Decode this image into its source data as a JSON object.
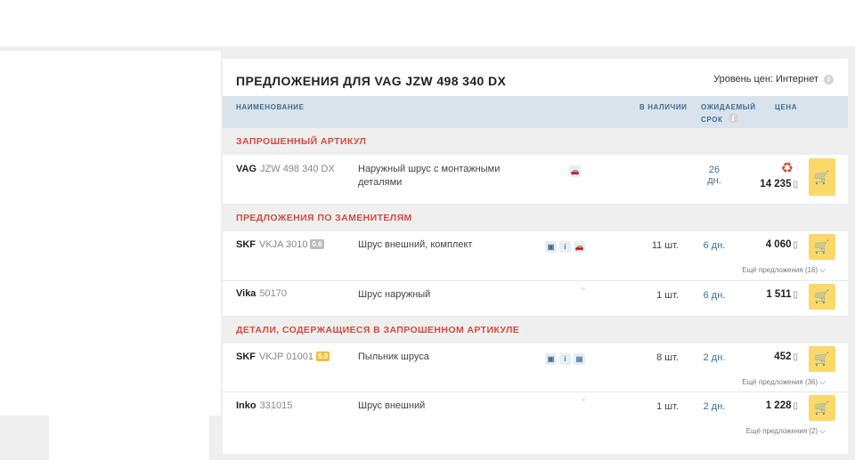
{
  "title": "ПРЕДЛОЖЕНИЯ ДЛЯ VAG JZW 498 340 DX",
  "price_level": "Уровень цен: Интернет",
  "columns": {
    "name": "НАИМЕНОВАНИЕ",
    "in_stock": "В НАЛИЧИИ",
    "expected_1": "ОЖИДАЕМЫЙ",
    "expected_2": "СРОК",
    "price": "ЦЕНА"
  },
  "sections": {
    "requested": "ЗАПРОШЕННЫЙ АРТИКУЛ",
    "replacements": "ПРЕДЛОЖЕНИЯ ПО ЗАМЕНИТЕЛЯМ",
    "contained": "ДЕТАЛИ, СОДЕРЖАЩИЕСЯ В ЗАПРОШЕННОМ АРТИКУЛЕ"
  },
  "rows": [
    {
      "brand": "VAG",
      "article": "JZW 498 340 DX",
      "rating": "",
      "desc": "Наружный шрус с монтажными деталями",
      "qty": "",
      "term": "26 дн.",
      "price": "14 235",
      "more": ""
    },
    {
      "brand": "SKF",
      "article": "VKJA 3010",
      "rating": "0.6",
      "desc": "Шрус внешний, комплект",
      "qty": "11 шт.",
      "term": "6 дн.",
      "price": "4 060",
      "more": "Ещё предложения (16)"
    },
    {
      "brand": "Vika",
      "article": "50170",
      "rating": "",
      "desc": "Шрус наружный",
      "qty": "1 шт.",
      "term": "6 дн.",
      "price": "1 511",
      "more": ""
    },
    {
      "brand": "SKF",
      "article": "VKJP 01001",
      "rating": "5.0",
      "desc": "Пыльник шруса",
      "qty": "8 шт.",
      "term": "2 дн.",
      "price": "452",
      "more": "Ещё предложения (36)"
    },
    {
      "brand": "Inko",
      "article": "331015",
      "rating": "",
      "desc": "Шрус внешний",
      "qty": "1 шт.",
      "term": "2 дн.",
      "price": "1 228",
      "more": "Ещё предложения (2)"
    }
  ],
  "icons": {
    "info": "i",
    "currency": "▯",
    "cart": "🛒",
    "recycle": "♻",
    "chevron": "⌵",
    "car": "🚗",
    "photo": "▣",
    "doc": "▤"
  },
  "colors": {
    "accent_red": "#d34b3c",
    "header_blue": "#3d6e96",
    "cart_yellow": "#fbd86a"
  }
}
